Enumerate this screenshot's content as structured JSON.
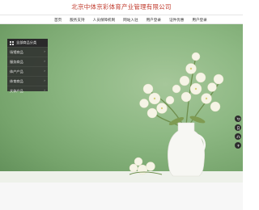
{
  "header": {
    "title": "北京中体京彩体育产业管理有限公司"
  },
  "nav": {
    "items": [
      "首页",
      "服务支持",
      "人员保障机制",
      "网站入驻",
      "用户登录",
      "证件优惠",
      "用户登录"
    ]
  },
  "categories": {
    "header_label": "全部商品分类",
    "items": [
      {
        "label": "场馆商品"
      },
      {
        "label": "服务商品"
      },
      {
        "label": "体产产品"
      },
      {
        "label": "体育商品"
      },
      {
        "label": "文体产品"
      }
    ]
  },
  "side_tools": {
    "icons": [
      "cart-icon",
      "bookmark-icon",
      "headset-icon",
      "arrow-up-icon"
    ]
  },
  "colors": {
    "title_red": "#c0392b",
    "hero_green": "#8db883",
    "panel_dark": "#2d2d2d"
  }
}
